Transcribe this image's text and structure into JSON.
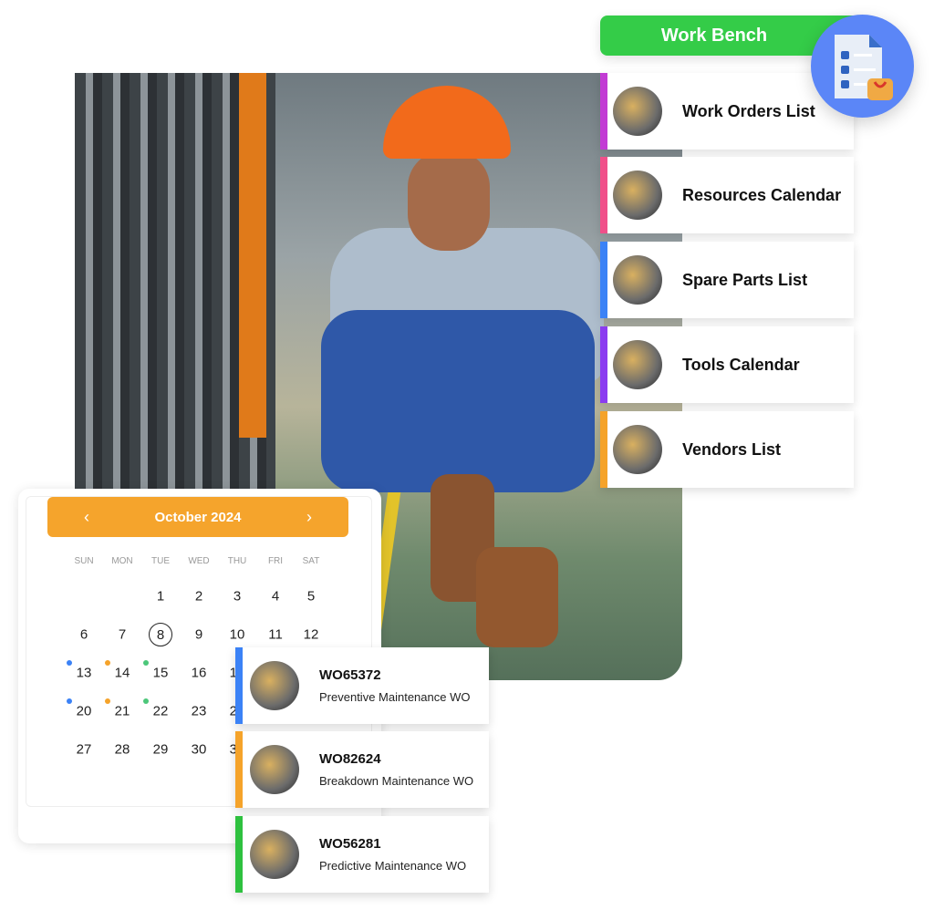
{
  "workbench": {
    "title": "Work Bench",
    "icon": "checklist-document-icon",
    "items": [
      {
        "label": "Work Orders List",
        "color": "#c23bd4"
      },
      {
        "label": "Resources Calendar",
        "color": "#f0508a"
      },
      {
        "label": "Spare Parts List",
        "color": "#3b82f6"
      },
      {
        "label": "Tools Calendar",
        "color": "#8b3cf0"
      },
      {
        "label": "Vendors List",
        "color": "#f5a32a"
      }
    ]
  },
  "calendar": {
    "month": "October 2024",
    "prev": "‹",
    "next": "›",
    "accent": "#f5a42c",
    "weekdays": [
      "SUN",
      "MON",
      "TUE",
      "WED",
      "THU",
      "FRI",
      "SAT"
    ],
    "selected": 8,
    "first_weekday": 2,
    "days": 31,
    "events": {
      "13": "#3b82f6",
      "14": "#f5a32a",
      "15": "#4cc77a",
      "20": "#3b82f6",
      "21": "#f5a32a",
      "22": "#4cc77a"
    }
  },
  "work_orders": [
    {
      "id": "WO65372",
      "type": "Preventive Maintenance WO",
      "color": "#3b82f6"
    },
    {
      "id": "WO82624",
      "type": "Breakdown Maintenance WO",
      "color": "#f5a32a"
    },
    {
      "id": "WO56281",
      "type": "Predictive Maintenance WO",
      "color": "#2ec13f"
    }
  ]
}
